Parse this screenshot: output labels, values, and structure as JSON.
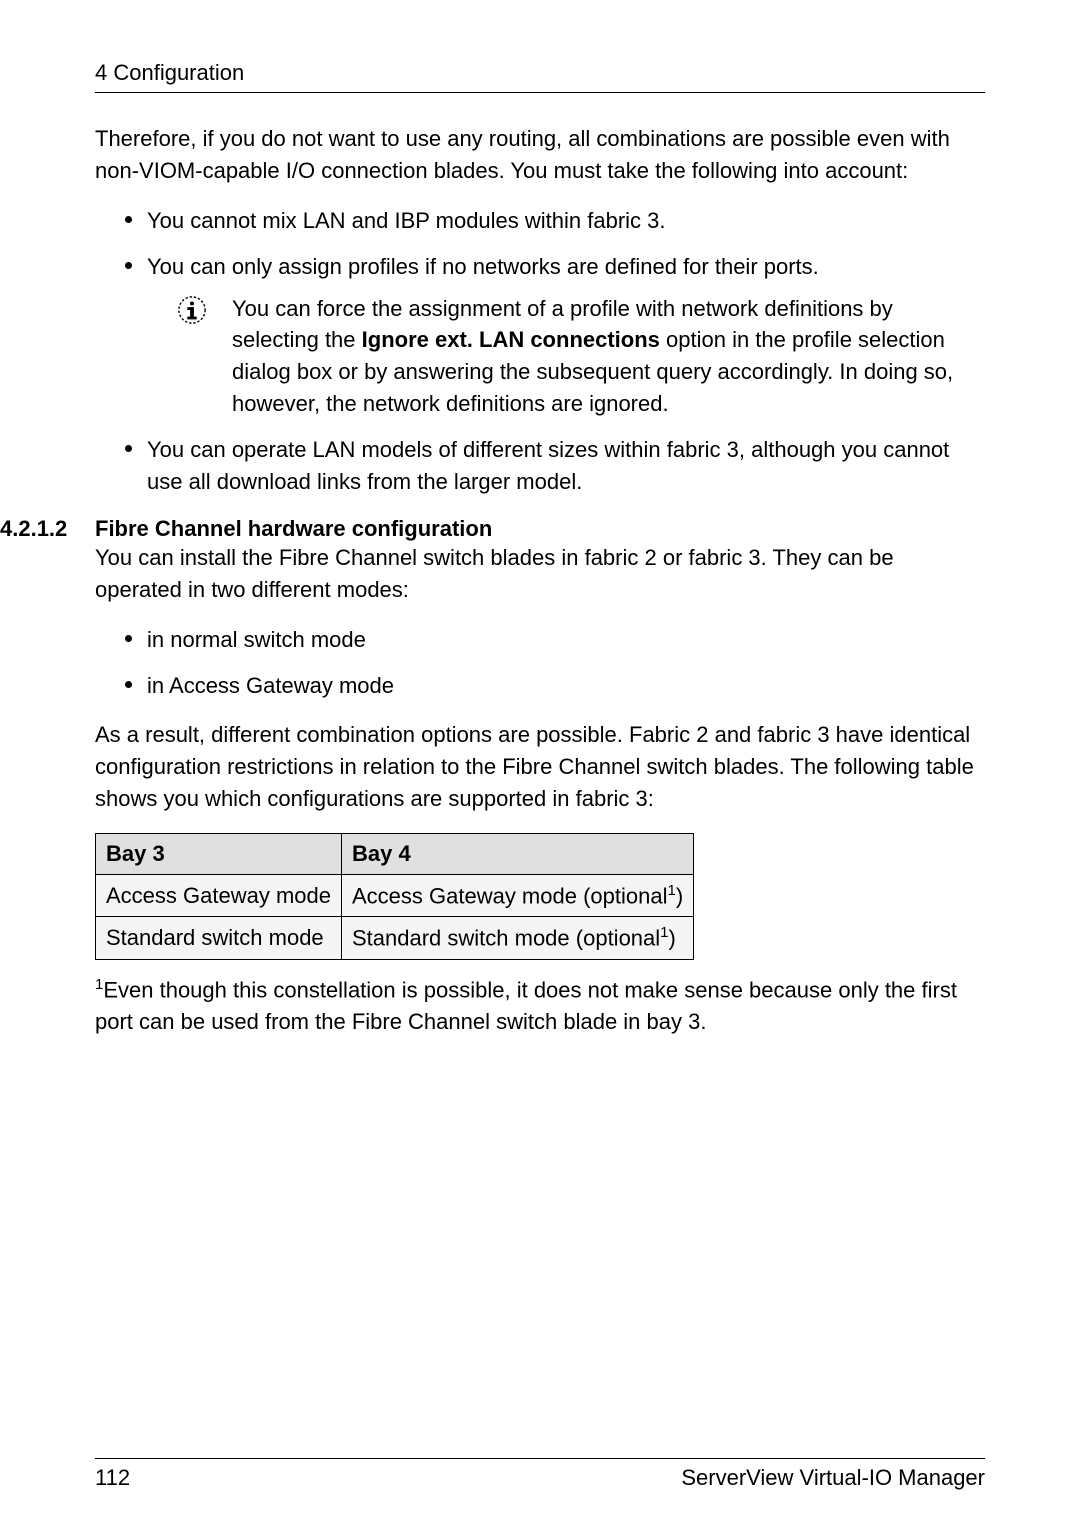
{
  "header": {
    "chapter": "4 Configuration"
  },
  "intro_text": "Therefore, if you do not want to use any routing, all combinations are possible even with non-VIOM-capable I/O connection blades. You must take the following into account:",
  "main_bullets": [
    "You cannot mix LAN and IBP modules within fabric 3.",
    "You can only assign profiles if no networks are defined for their ports."
  ],
  "info_prefix": "You can force the assignment of a profile with network definitions by selecting the ",
  "info_bold": "Ignore ext. LAN connections",
  "info_suffix": " option in the profile selection dialog box or by answering the subsequent query accordingly. In doing so, however, the network definitions are ignored.",
  "last_bullet": "You can operate LAN models of different sizes within fabric 3, although you cannot use all download links from the larger model.",
  "section": {
    "number": "4.2.1.2",
    "title": "Fibre Channel hardware configuration"
  },
  "section_text1": "You can install the Fibre Channel switch blades in fabric 2 or fabric 3. They can be operated in two different modes:",
  "mode_bullets": [
    "in normal switch mode",
    "in Access Gateway mode"
  ],
  "section_text2": "As a result, different combination options are possible. Fabric 2 and fabric 3 have identical configuration restrictions in relation to the Fibre Channel switch blades. The following table shows you which configurations are supported in fabric 3:",
  "table": {
    "headers": [
      "Bay 3",
      "Bay 4"
    ],
    "rows": [
      {
        "bay3": "Access Gateway mode",
        "bay4_pre": "Access Gateway mode (optional",
        "bay4_sup": "1",
        "bay4_post": ")"
      },
      {
        "bay3": "Standard switch mode",
        "bay4_pre": "Standard switch mode (optional",
        "bay4_sup": "1",
        "bay4_post": ")"
      }
    ]
  },
  "footnote_sup": "1",
  "footnote_text": "Even though this constellation is possible, it does not make sense because only the first port can be used from the Fibre Channel switch blade in bay 3.",
  "footer": {
    "page": "112",
    "product": "ServerView Virtual-IO Manager"
  }
}
